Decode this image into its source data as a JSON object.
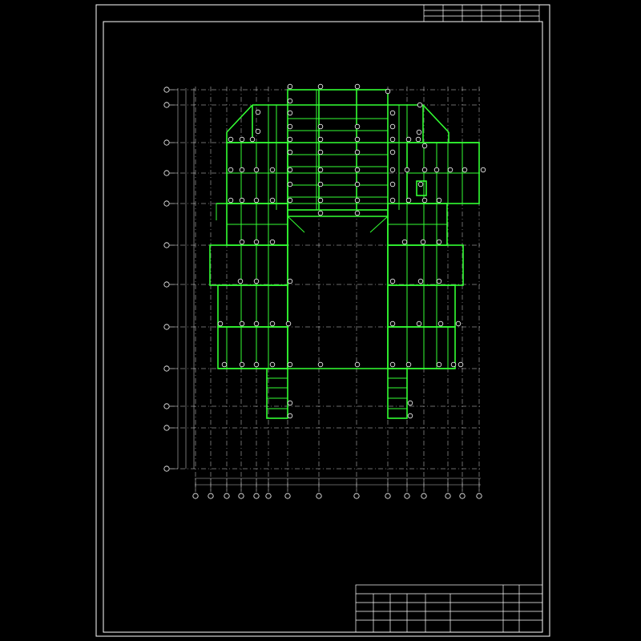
{
  "drawing": {
    "type": "structural-floor-framing-plan",
    "beam_color": "#33ff33",
    "title_color": "#ff2020",
    "line_color": "#ffffff",
    "background": "#000000"
  },
  "grid": {
    "rows": [
      "",
      "",
      "",
      "",
      "",
      "",
      "",
      "",
      "",
      "",
      "",
      ""
    ],
    "columns": [
      "",
      "",
      "",
      "",
      "",
      "",
      "",
      "",
      "",
      "",
      "",
      "",
      "",
      "",
      "",
      ""
    ]
  },
  "drawing_title": "",
  "title_block": {
    "rows": [
      [
        "",
        "",
        "",
        "",
        ""
      ],
      [
        "",
        "",
        "",
        "",
        ""
      ],
      [
        "",
        "",
        "",
        "",
        ""
      ],
      [
        "",
        "",
        "",
        "",
        ""
      ],
      [
        "",
        "",
        "",
        "",
        ""
      ]
    ]
  }
}
